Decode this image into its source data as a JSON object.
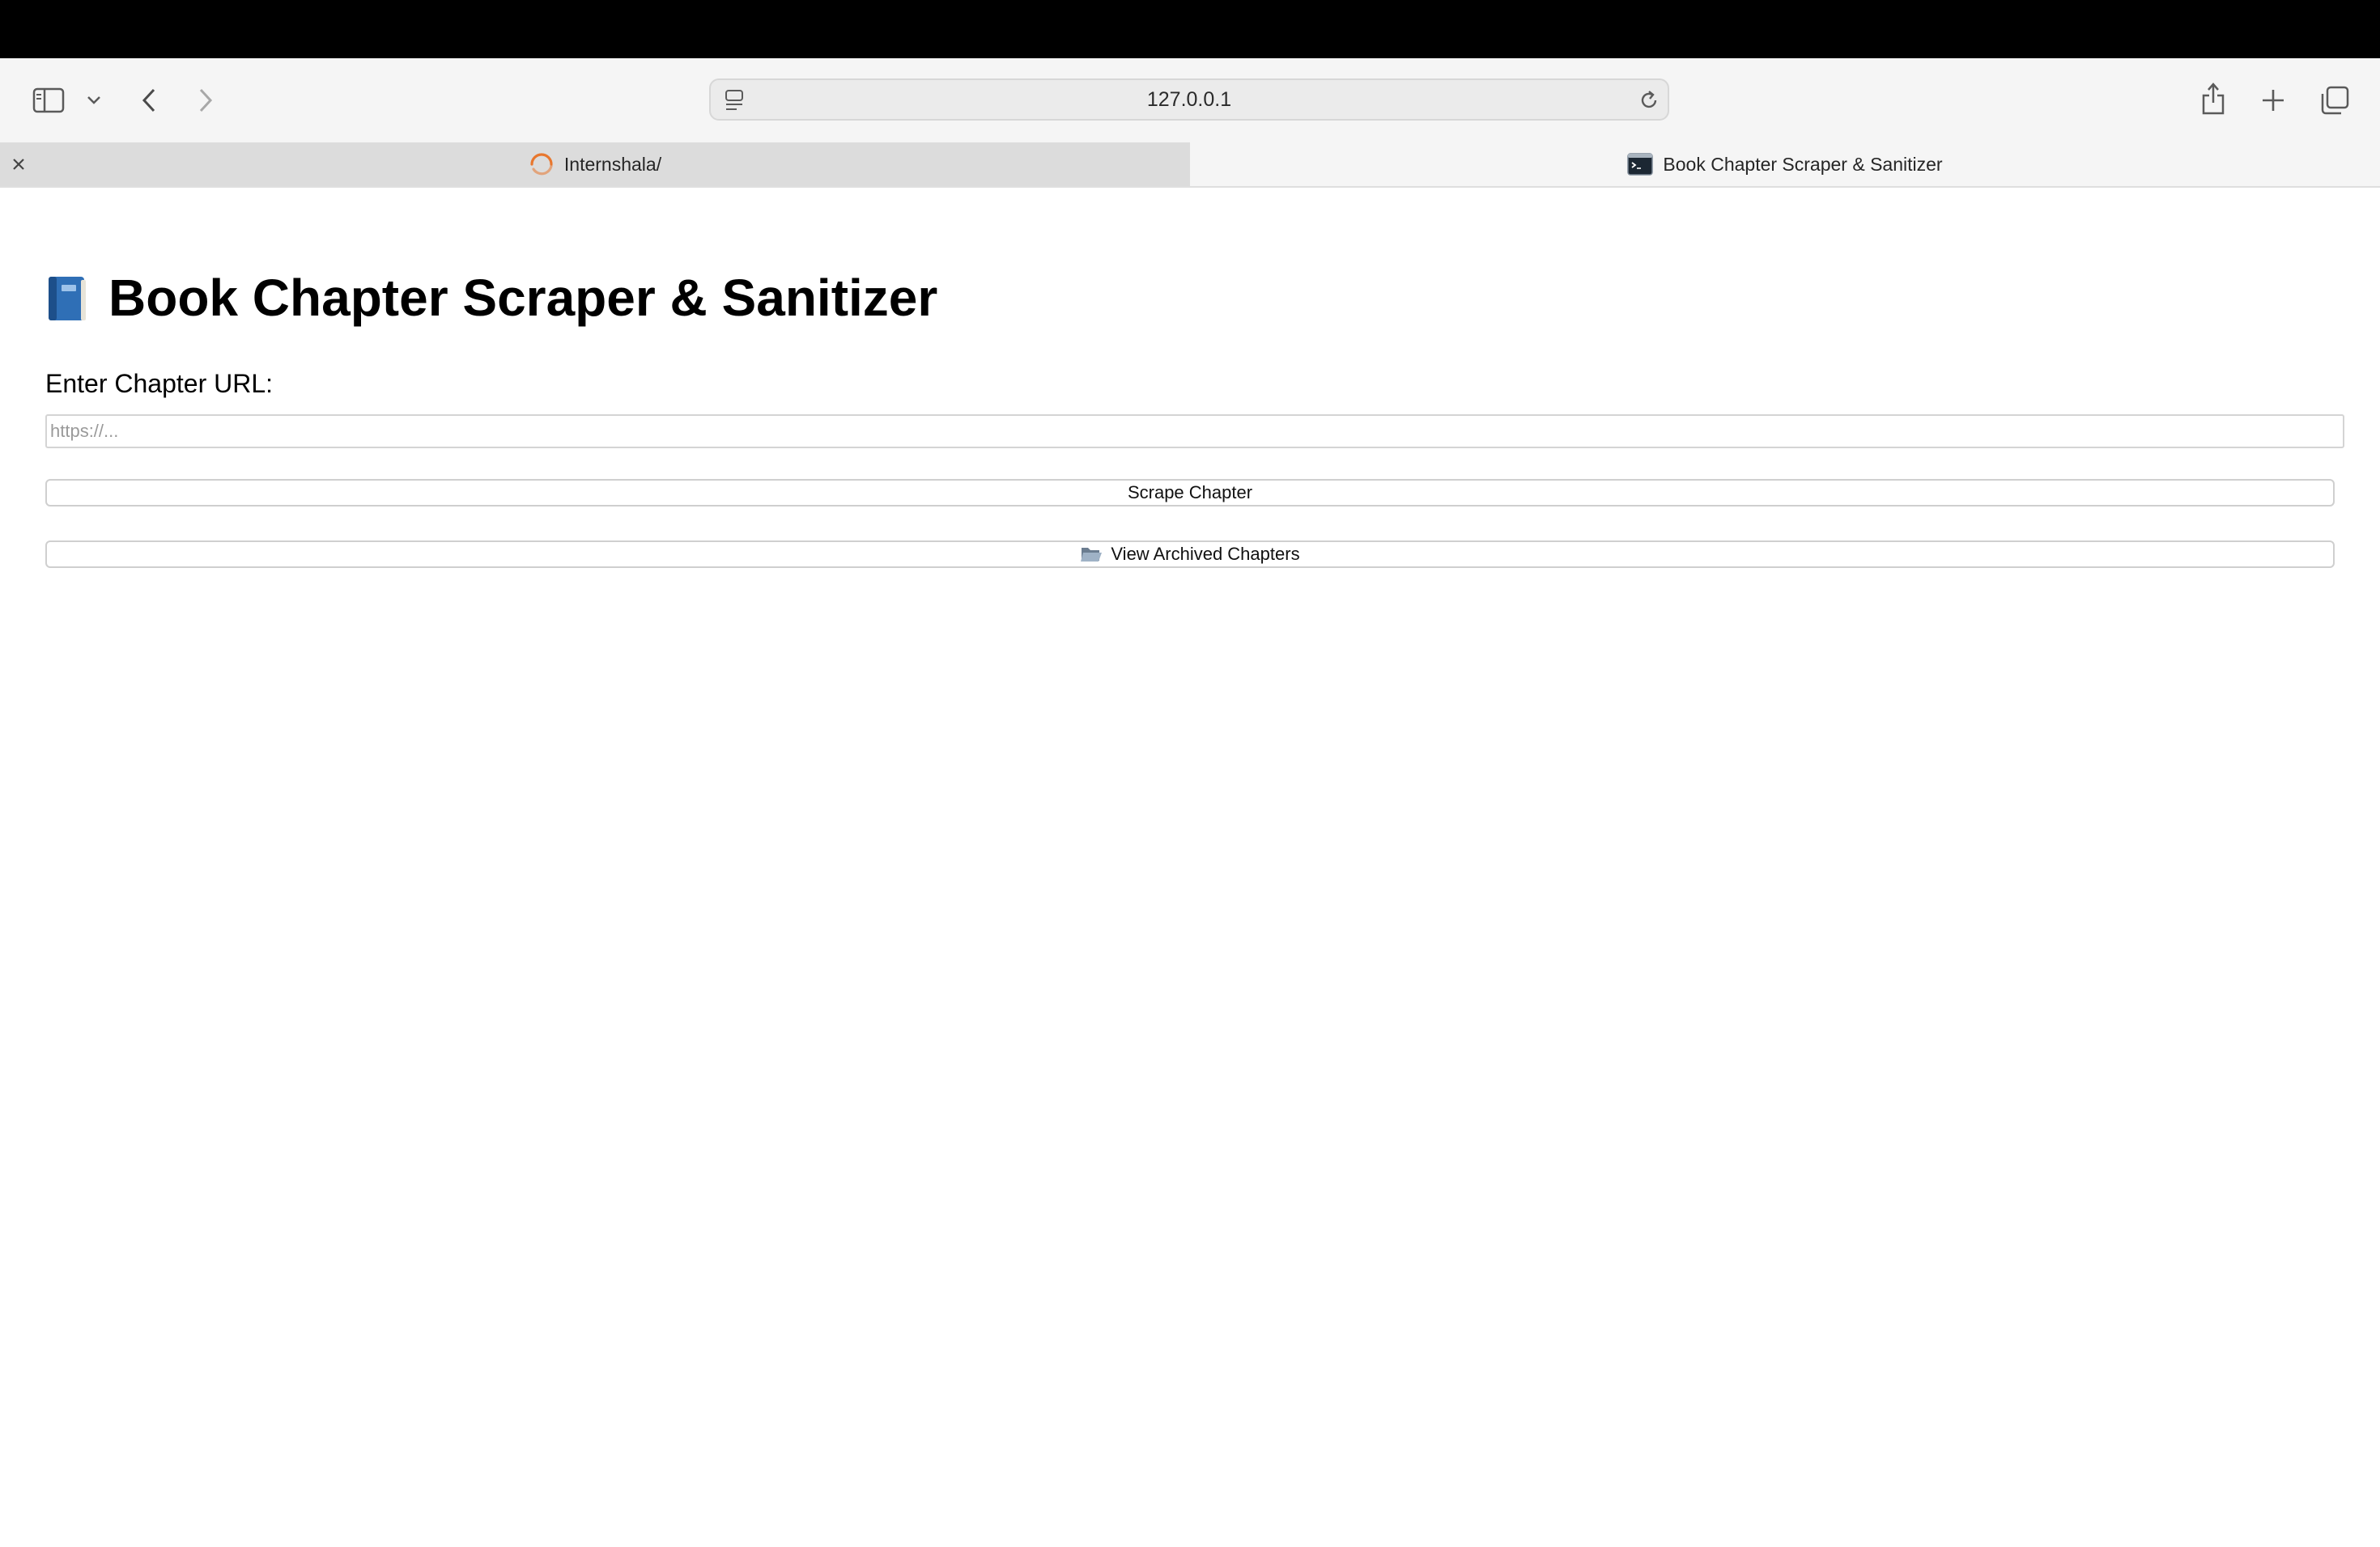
{
  "browser": {
    "address": "127.0.0.1",
    "tabs": [
      {
        "title": "Internshala/",
        "active": false,
        "icon": "loading-spinner-icon"
      },
      {
        "title": "Book Chapter Scraper & Sanitizer",
        "active": true,
        "icon": "terminal-icon"
      }
    ]
  },
  "page": {
    "title": "Book Chapter Scraper & Sanitizer",
    "title_icon": "blue-book-icon",
    "url_label": "Enter Chapter URL:",
    "url_placeholder": "https://...",
    "url_value": "",
    "scrape_button": "Scrape Chapter",
    "archive_button": "View Archived Chapters",
    "archive_icon": "open-folder-icon"
  },
  "colors": {
    "spinner": "#e8772e",
    "book": "#2f6fb6"
  }
}
